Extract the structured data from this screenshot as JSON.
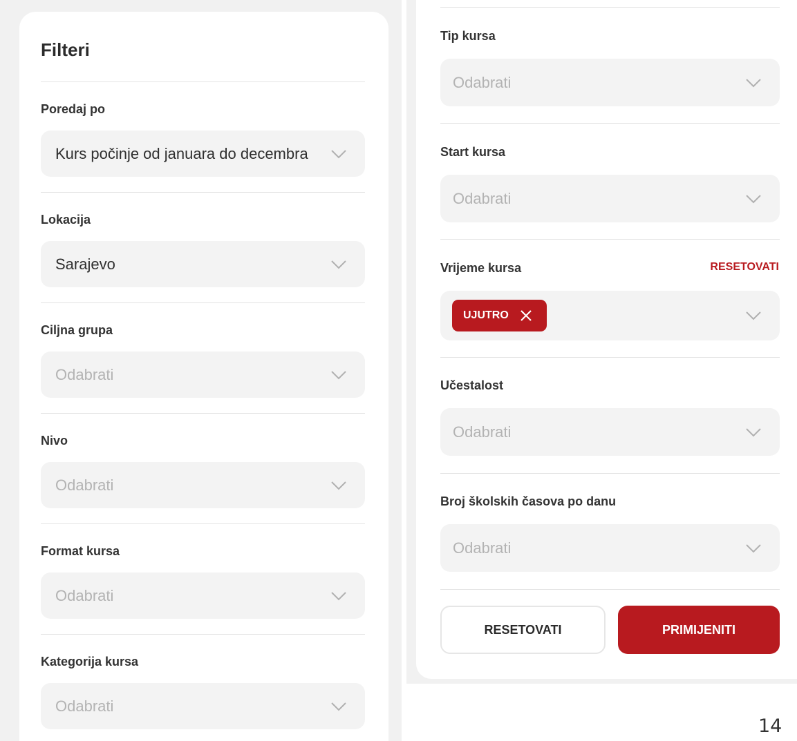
{
  "filters": {
    "title": "Filteri",
    "placeholder": "Odabrati",
    "sort": {
      "label": "Poredaj po",
      "value": "Kurs počinje od januara do decembra"
    },
    "location": {
      "label": "Lokacija",
      "value": "Sarajevo"
    },
    "target_group": {
      "label": "Ciljna grupa"
    },
    "level": {
      "label": "Nivo"
    },
    "format": {
      "label": "Format kursa"
    },
    "category": {
      "label": "Kategorija kursa"
    },
    "course_type": {
      "label": "Tip kursa"
    },
    "course_start": {
      "label": "Start kursa"
    },
    "course_time": {
      "label": "Vrijeme kursa",
      "reset_label": "RESETOVATI",
      "chip": "UJUTRO"
    },
    "frequency": {
      "label": "Učestalost"
    },
    "hours_per_day": {
      "label": "Broj školskih časova po danu"
    }
  },
  "actions": {
    "reset_label": "RESETOVATI",
    "apply_label": "PRIMIJENITI"
  },
  "page_number": "14",
  "colors": {
    "accent": "#b81a1f",
    "field_bg": "#f3f3f3",
    "panel_bg": "#f1f1f1"
  },
  "icons": {
    "dropdown": "chevron-down-icon",
    "remove": "close-icon"
  }
}
